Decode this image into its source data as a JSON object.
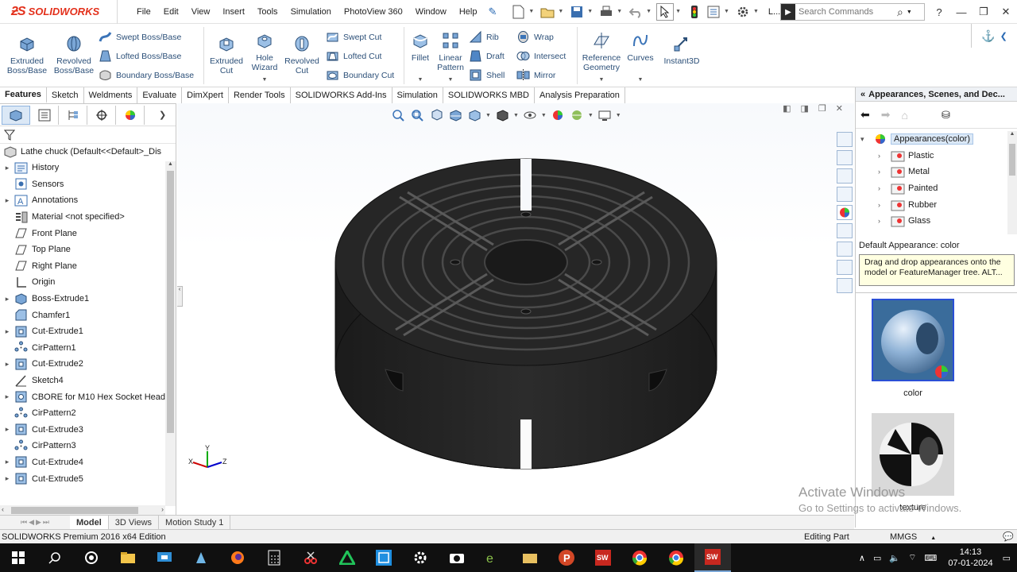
{
  "app": {
    "brand": "SOLIDWORKS",
    "menu": [
      "File",
      "Edit",
      "View",
      "Insert",
      "Tools",
      "Simulation",
      "PhotoView 360",
      "Window",
      "Help"
    ],
    "search_placeholder": "Search Commands",
    "user_label": "L..."
  },
  "ribbon": {
    "extruded_boss": "Extruded\nBoss/Base",
    "revolved_boss": "Revolved\nBoss/Base",
    "swept_boss": "Swept Boss/Base",
    "lofted_boss": "Lofted Boss/Base",
    "boundary_boss": "Boundary Boss/Base",
    "extruded_cut": "Extruded\nCut",
    "hole_wizard": "Hole\nWizard",
    "revolved_cut": "Revolved\nCut",
    "swept_cut": "Swept Cut",
    "lofted_cut": "Lofted Cut",
    "boundary_cut": "Boundary Cut",
    "fillet": "Fillet",
    "linear_pattern": "Linear\nPattern",
    "rib": "Rib",
    "draft": "Draft",
    "shell": "Shell",
    "wrap": "Wrap",
    "intersect": "Intersect",
    "mirror": "Mirror",
    "reference_geometry": "Reference\nGeometry",
    "curves": "Curves",
    "instant3d": "Instant3D"
  },
  "tabs": [
    "Features",
    "Sketch",
    "Weldments",
    "Evaluate",
    "DimXpert",
    "Render Tools",
    "SOLIDWORKS Add-Ins",
    "Simulation",
    "SOLIDWORKS MBD",
    "Analysis Preparation"
  ],
  "feature_tree": {
    "root": "Lathe chuck  (Default<<Default>_Dis",
    "nodes": [
      {
        "label": "History",
        "expandable": true,
        "icon": "history-icon"
      },
      {
        "label": "Sensors",
        "expandable": false,
        "icon": "sensor-icon"
      },
      {
        "label": "Annotations",
        "expandable": true,
        "icon": "annotation-icon"
      },
      {
        "label": "Material <not specified>",
        "expandable": false,
        "icon": "material-icon"
      },
      {
        "label": "Front Plane",
        "expandable": false,
        "icon": "plane-icon"
      },
      {
        "label": "Top Plane",
        "expandable": false,
        "icon": "plane-icon"
      },
      {
        "label": "Right Plane",
        "expandable": false,
        "icon": "plane-icon"
      },
      {
        "label": "Origin",
        "expandable": false,
        "icon": "origin-icon"
      },
      {
        "label": "Boss-Extrude1",
        "expandable": true,
        "icon": "extrude-icon"
      },
      {
        "label": "Chamfer1",
        "expandable": false,
        "icon": "chamfer-icon"
      },
      {
        "label": "Cut-Extrude1",
        "expandable": true,
        "icon": "cut-icon"
      },
      {
        "label": "CirPattern1",
        "expandable": false,
        "icon": "pattern-icon"
      },
      {
        "label": "Cut-Extrude2",
        "expandable": true,
        "icon": "cut-icon"
      },
      {
        "label": "Sketch4",
        "expandable": false,
        "icon": "sketch-icon"
      },
      {
        "label": "CBORE for M10 Hex Socket Head",
        "expandable": true,
        "icon": "hole-icon"
      },
      {
        "label": "CirPattern2",
        "expandable": false,
        "icon": "pattern-icon"
      },
      {
        "label": "Cut-Extrude3",
        "expandable": true,
        "icon": "cut-icon"
      },
      {
        "label": "CirPattern3",
        "expandable": false,
        "icon": "pattern-icon"
      },
      {
        "label": "Cut-Extrude4",
        "expandable": true,
        "icon": "cut-icon"
      },
      {
        "label": "Cut-Extrude5",
        "expandable": true,
        "icon": "cut-icon"
      }
    ]
  },
  "bottom_tabs": [
    "Model",
    "3D Views",
    "Motion Study 1"
  ],
  "task_pane": {
    "header": "Appearances, Scenes, and Dec...",
    "tree": [
      {
        "label": "Appearances(color)",
        "expanded": true
      },
      {
        "label": "Plastic"
      },
      {
        "label": "Metal"
      },
      {
        "label": "Painted"
      },
      {
        "label": "Rubber"
      },
      {
        "label": "Glass"
      }
    ],
    "default_label": "Default Appearance: color",
    "tip": "Drag and drop appearances onto the model or FeatureManager tree.  ALT...",
    "swatches": [
      "color",
      "texture"
    ]
  },
  "status": {
    "edition": "SOLIDWORKS Premium 2016 x64 Edition",
    "mode": "Editing Part",
    "units": "MMGS"
  },
  "watermark": {
    "line1": "Activate Windows",
    "line2": "Go to Settings to activate Windows."
  },
  "taskbar": {
    "time": "14:13",
    "date": "07-01-2024"
  }
}
